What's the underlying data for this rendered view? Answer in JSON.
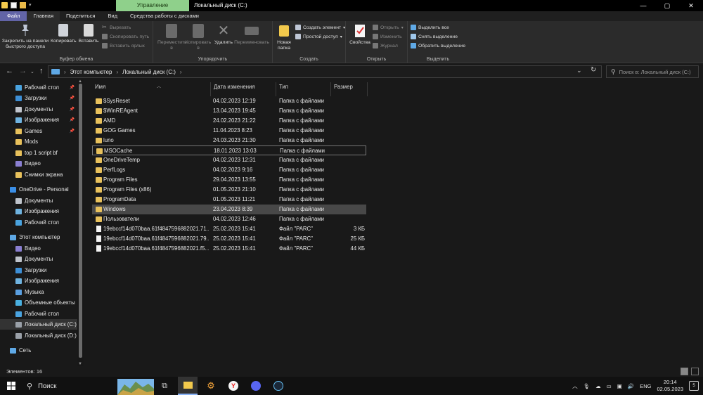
{
  "window": {
    "title": "Локальный диск (C:)",
    "context_tab": "Управление",
    "controls": [
      "—",
      "▢",
      "✕"
    ]
  },
  "ribbon_tabs": [
    "Файл",
    "Главная",
    "Поделиться",
    "Вид",
    "Средства работы с дисками"
  ],
  "ribbon": {
    "clipboard": {
      "pin_label": "Закрепить на панели быстрого доступа",
      "copy_label": "Копировать",
      "paste_label": "Вставить",
      "cut_label": "Вырезать",
      "copy_path_label": "Скопировать путь",
      "paste_shortcut_label": "Вставить ярлык",
      "group_label": "Буфер обмена"
    },
    "organize": {
      "move_label": "Переместить в",
      "copy_to_label": "Копировать в",
      "delete_label": "Удалить",
      "rename_label": "Переименовать",
      "group_label": "Упорядочить"
    },
    "create": {
      "new_folder_label": "Новая папка",
      "new_item_label": "Создать элемент",
      "easy_access_label": "Простой доступ",
      "group_label": "Создать"
    },
    "open": {
      "properties_label": "Свойства",
      "open_label": "Открыть",
      "edit_label": "Изменить",
      "history_label": "Журнал",
      "group_label": "Открыть"
    },
    "select": {
      "select_all_label": "Выделить все",
      "select_none_label": "Снять выделение",
      "invert_label": "Обратить выделение",
      "group_label": "Выделить"
    }
  },
  "address": {
    "crumb1": "Этот компьютер",
    "crumb2": "Локальный диск (C:)",
    "search_placeholder": "Поиск в: Локальный диск (C:)"
  },
  "nav_pane": [
    {
      "label": "Рабочий стол",
      "pinned": true,
      "color": "#4aa3df"
    },
    {
      "label": "Загрузки",
      "pinned": true,
      "color": "#3d8fd6"
    },
    {
      "label": "Документы",
      "pinned": true,
      "color": "#bfc4cc"
    },
    {
      "label": "Изображения",
      "pinned": true,
      "color": "#6fb3e0"
    },
    {
      "label": "Games",
      "pinned": true,
      "color": "#e8c15c"
    },
    {
      "label": "Mods",
      "pinned": false,
      "color": "#e8c15c"
    },
    {
      "label": "top 1 script bf",
      "pinned": false,
      "color": "#e8c15c"
    },
    {
      "label": "Видео",
      "pinned": false,
      "color": "#8a7fd1"
    },
    {
      "label": "Снимки экрана",
      "pinned": false,
      "color": "#e8c15c"
    },
    {
      "label": "OneDrive - Personal",
      "pinned": false,
      "color": "#3a8ee6"
    },
    {
      "label": "Документы",
      "pinned": false,
      "color": "#bfc4cc"
    },
    {
      "label": "Изображения",
      "pinned": false,
      "color": "#6fb3e0"
    },
    {
      "label": "Рабочий стол",
      "pinned": false,
      "color": "#4aa3df"
    },
    {
      "label": "Этот компьютер",
      "pinned": false,
      "color": "#5fa9e6"
    },
    {
      "label": "Видео",
      "pinned": false,
      "color": "#8a7fd1"
    },
    {
      "label": "Документы",
      "pinned": false,
      "color": "#bfc4cc"
    },
    {
      "label": "Загрузки",
      "pinned": false,
      "color": "#3d8fd6"
    },
    {
      "label": "Изображения",
      "pinned": false,
      "color": "#6fb3e0"
    },
    {
      "label": "Музыка",
      "pinned": false,
      "color": "#5a9fe0"
    },
    {
      "label": "Объемные объекты",
      "pinned": false,
      "color": "#4ab0e0"
    },
    {
      "label": "Рабочий стол",
      "pinned": false,
      "color": "#4aa3df"
    },
    {
      "label": "Локальный диск (C:)",
      "pinned": false,
      "color": "#9aa0a8",
      "selected": true
    },
    {
      "label": "Локальный диск (D:)",
      "pinned": false,
      "color": "#9aa0a8"
    },
    {
      "label": "Сеть",
      "pinned": false,
      "color": "#5fa9e6"
    }
  ],
  "columns": {
    "name": "Имя",
    "date": "Дата изменения",
    "type": "Тип",
    "size": "Размер"
  },
  "files": [
    {
      "name": "$SysReset",
      "date": "04.02.2023 12:19",
      "type": "Папка с файлами",
      "size": "",
      "kind": "folder"
    },
    {
      "name": "$WinREAgent",
      "date": "13.04.2023 19:45",
      "type": "Папка с файлами",
      "size": "",
      "kind": "folder"
    },
    {
      "name": "AMD",
      "date": "24.02.2023 21:22",
      "type": "Папка с файлами",
      "size": "",
      "kind": "folder"
    },
    {
      "name": "GOG Games",
      "date": "11.04.2023 8:23",
      "type": "Папка с файлами",
      "size": "",
      "kind": "folder"
    },
    {
      "name": "luno",
      "date": "24.03.2023 21:30",
      "type": "Папка с файлами",
      "size": "",
      "kind": "folder"
    },
    {
      "name": "MSOCache",
      "date": "18.01.2023 13:03",
      "type": "Папка с файлами",
      "size": "",
      "kind": "folder"
    },
    {
      "name": "OneDriveTemp",
      "date": "04.02.2023 12:31",
      "type": "Папка с файлами",
      "size": "",
      "kind": "folder"
    },
    {
      "name": "PerfLogs",
      "date": "04.02.2023 9:16",
      "type": "Папка с файлами",
      "size": "",
      "kind": "folder"
    },
    {
      "name": "Program Files",
      "date": "29.04.2023 13:55",
      "type": "Папка с файлами",
      "size": "",
      "kind": "folder"
    },
    {
      "name": "Program Files (x86)",
      "date": "01.05.2023 21:10",
      "type": "Папка с файлами",
      "size": "",
      "kind": "folder"
    },
    {
      "name": "ProgramData",
      "date": "01.05.2023 11:21",
      "type": "Папка с файлами",
      "size": "",
      "kind": "folder"
    },
    {
      "name": "Windows",
      "date": "23.04.2023 8:39",
      "type": "Папка с файлами",
      "size": "",
      "kind": "folder"
    },
    {
      "name": "Пользователи",
      "date": "04.02.2023 12:46",
      "type": "Папка с файлами",
      "size": "",
      "kind": "folder"
    },
    {
      "name": "19ebccf14d070baa.61f48475968820​21.71...",
      "date": "25.02.2023 15:41",
      "type": "Файл \"PARC\"",
      "size": "3 КБ",
      "kind": "file"
    },
    {
      "name": "19ebccf14d070baa.61f4847596882021.79...",
      "date": "25.02.2023 15:41",
      "type": "Файл \"PARC\"",
      "size": "25 КБ",
      "kind": "file"
    },
    {
      "name": "19ebccf14d070baa.61f4847596882021.f5...",
      "date": "25.02.2023 15:41",
      "type": "Файл \"PARC\"",
      "size": "44 КБ",
      "kind": "file"
    }
  ],
  "status": {
    "count": "Элементов: 16"
  },
  "taskbar": {
    "search_label": "Поиск",
    "lang": "ENG",
    "time": "20:14",
    "date": "02.05.2023",
    "notif_count": "5"
  }
}
